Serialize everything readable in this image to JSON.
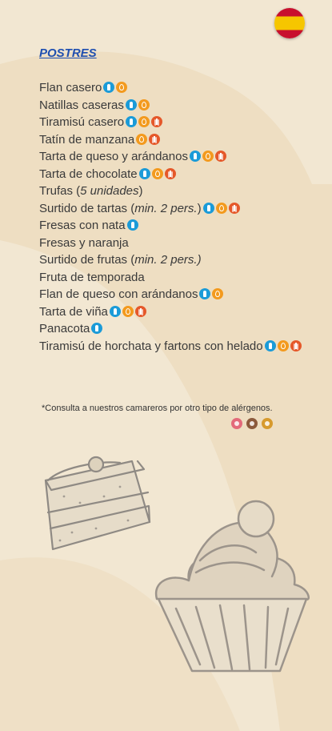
{
  "header": {
    "title": "POSTRES",
    "language_icon": "spain-flag-icon"
  },
  "colors": {
    "background": "#f2e7d2",
    "title": "#1f4fb0",
    "milk": "#1b9bd8",
    "egg": "#f39a1e",
    "gluten": "#e5582a",
    "shellfish": "#e36a7a",
    "nuts": "#8c5a3c",
    "peanut": "#d79a2d"
  },
  "menu": {
    "items": [
      {
        "name": "Flan casero",
        "note": "",
        "suffix": "",
        "allergens": [
          "milk",
          "egg"
        ]
      },
      {
        "name": "Natillas caseras",
        "note": "",
        "suffix": "",
        "allergens": [
          "milk",
          "egg"
        ]
      },
      {
        "name": "Tiramisú casero",
        "note": "",
        "suffix": "",
        "allergens": [
          "milk",
          "egg",
          "gluten"
        ]
      },
      {
        "name": "Tatín de manzana",
        "note": "",
        "suffix": "",
        "allergens": [
          "egg",
          "gluten"
        ]
      },
      {
        "name": "Tarta de queso y arándanos",
        "note": "",
        "suffix": "",
        "allergens": [
          "milk",
          "egg",
          "gluten"
        ]
      },
      {
        "name": "Tarta de chocolate",
        "note": "",
        "suffix": "",
        "allergens": [
          "milk",
          "egg",
          "gluten"
        ]
      },
      {
        "name": "Trufas (",
        "note": "5 unidades",
        "suffix": ")",
        "allergens": []
      },
      {
        "name": "Surtido de tartas (",
        "note": "min. 2 pers.",
        "suffix": ")",
        "allergens": [
          "milk",
          "egg",
          "gluten"
        ]
      },
      {
        "name": "Fresas con nata",
        "note": "",
        "suffix": "",
        "allergens": [
          "milk"
        ]
      },
      {
        "name": "Fresas y naranja",
        "note": "",
        "suffix": "",
        "allergens": []
      },
      {
        "name": "Surtido de frutas (",
        "note": "min. 2 pers.)",
        "suffix": "",
        "allergens": []
      },
      {
        "name": "Fruta de temporada",
        "note": "",
        "suffix": "",
        "allergens": []
      },
      {
        "name": "Flan de queso con arándanos",
        "note": "",
        "suffix": "",
        "allergens": [
          "milk",
          "egg"
        ]
      },
      {
        "name": "Tarta de viña",
        "note": "",
        "suffix": "",
        "allergens": [
          "milk",
          "egg",
          "gluten"
        ]
      },
      {
        "name": "Panacota",
        "note": "",
        "suffix": "",
        "allergens": [
          "milk"
        ]
      },
      {
        "name": "Tiramisú de horchata y fartons con helado",
        "note": "",
        "suffix": "",
        "allergens": [
          "milk",
          "egg",
          "gluten"
        ]
      }
    ]
  },
  "footnote": {
    "text": "*Consulta a nuestros camareros por otro tipo de alérgenos.",
    "allergens": [
      "shellfish",
      "nuts",
      "peanut"
    ]
  }
}
